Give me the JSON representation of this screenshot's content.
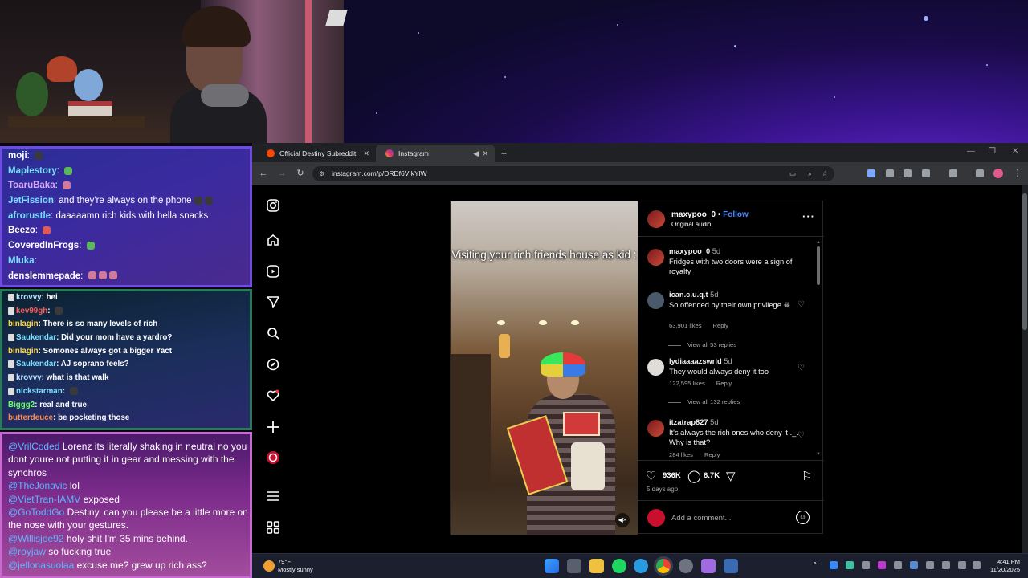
{
  "colors": {
    "ig_blue": "#4a8aff",
    "chat3_user": "#5ab8ff",
    "taskbar": "#1b1f2e"
  },
  "chat1": [
    {
      "user": "moji",
      "color": "#ffffff",
      "msg": "",
      "emotes": [
        "d"
      ]
    },
    {
      "user": "Maplestory",
      "color": "#7adfff",
      "msg": "",
      "emotes": [
        "g"
      ]
    },
    {
      "user": "ToaruBaka",
      "color": "#d8a8ff",
      "msg": "",
      "emotes": [
        "p"
      ]
    },
    {
      "user": "JetFission",
      "color": "#7adfff",
      "msg": "and they're always on the phone",
      "emotes": [
        "d",
        "d"
      ]
    },
    {
      "user": "afrorustle",
      "color": "#7adfff",
      "msg": "daaaaamn rich kids with hella snacks",
      "emotes": []
    },
    {
      "user": "Beezo",
      "color": "#ffffff",
      "msg": "",
      "emotes": [
        "r"
      ]
    },
    {
      "user": "CoveredInFrogs",
      "color": "#ffffff",
      "msg": "",
      "emotes": [
        "g"
      ]
    },
    {
      "user": "Mluka",
      "color": "#7adfff",
      "msg": "",
      "emotes": []
    },
    {
      "user": "denslemmepade",
      "color": "#ffffff",
      "msg": "",
      "emotes": [
        "p",
        "p",
        "p"
      ]
    }
  ],
  "chat2": [
    {
      "badge": true,
      "user": "krovvy",
      "color": "#b8e0ff",
      "msg": "hei"
    },
    {
      "badge": true,
      "user": "kev99gh",
      "color": "#ff5a5a",
      "msg": ""
    },
    {
      "badge": false,
      "user": "binlagin",
      "color": "#ffd84a",
      "msg": "There is so many levels of rich"
    },
    {
      "badge": true,
      "user": "Saukendar",
      "color": "#7adfff",
      "msg": "Did your mom have a yardro?"
    },
    {
      "badge": false,
      "user": "binlagin",
      "color": "#ffd84a",
      "msg": "Somones always got a bigger Yact"
    },
    {
      "badge": true,
      "user": "Saukendar",
      "color": "#7adfff",
      "msg": "AJ soprano feels?"
    },
    {
      "badge": true,
      "user": "krovvy",
      "color": "#b8e0ff",
      "msg": "what is that walk"
    },
    {
      "badge": true,
      "user": "nickstarman",
      "color": "#7adfff",
      "msg": ""
    },
    {
      "badge": false,
      "user": "Biggg2",
      "color": "#6aff6a",
      "msg": "real and true"
    },
    {
      "badge": false,
      "user": "butterdeuce",
      "color": "#ff8a4a",
      "msg": "be pocketing those"
    }
  ],
  "chat3": [
    {
      "user": "@VrilCoded",
      "msg": "Lorenz its literally shaking in neutral no you dont youre not putting it in gear and messing with the synchros"
    },
    {
      "user": "@TheJonavic",
      "msg": "lol"
    },
    {
      "user": "@VietTran-IAMV",
      "msg": "exposed"
    },
    {
      "user": "@GoToddGo",
      "msg": "Destiny, can you please be a little more on the nose with your gestures."
    },
    {
      "user": "@Willisjoe92",
      "msg": "holy shit I'm 35 mins behind."
    },
    {
      "user": "@royjaw",
      "msg": "so fucking true"
    },
    {
      "user": "@jellonasuolaa",
      "msg": "excuse me? grew up rich ass?"
    }
  ],
  "browser": {
    "tab1": "Official Destiny Subreddit",
    "tab2": "Instagram",
    "url": "instagram.com/p/DRDf6VIkYlW"
  },
  "post": {
    "video_caption": "Visiting your rich friends house as kid :",
    "author": "maxypoo_0",
    "follow": "Follow",
    "audio": "Original audio",
    "likes": "936K",
    "comments_count": "6.7K",
    "posted": "5 days ago",
    "add_comment": "Add a comment...",
    "comments": [
      {
        "user": "maxypoo_0",
        "time": "5d",
        "text": "Fridges with two doors were a sign of royalty",
        "likes": "",
        "reply": "",
        "view_all": ""
      },
      {
        "user": "ican.c.u.q.t",
        "time": "5d",
        "text": "So offended by their own privilege ☠",
        "likes": "63,901 likes",
        "reply": "Reply",
        "view_all": "View all 53 replies"
      },
      {
        "user": "lydiaaaazswrld",
        "time": "5d",
        "text": "They would always deny it too",
        "likes": "122,595 likes",
        "reply": "Reply",
        "view_all": "View all 132 replies"
      },
      {
        "user": "itzatrap827",
        "time": "5d",
        "text": "It's always the rich ones who deny it ._. Why is that?",
        "likes": "284 likes",
        "reply": "Reply",
        "view_all": ""
      }
    ]
  },
  "taskbar": {
    "temp": "79°F",
    "weather": "Mostly sunny",
    "time": "4:41 PM",
    "date": "11/20/2025"
  }
}
